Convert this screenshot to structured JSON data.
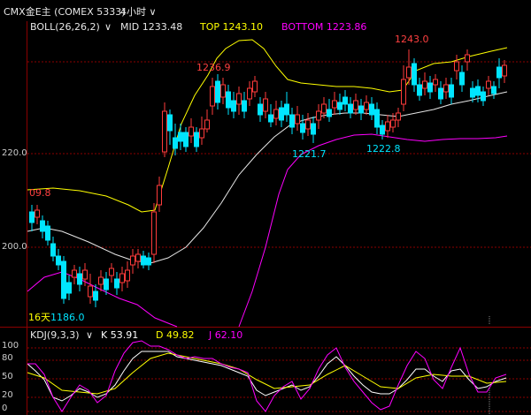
{
  "header": {
    "title": "CMX金E主 (COMEX 5333)",
    "period": "4小时",
    "period_icon": "chevron-down-icon"
  },
  "boll": {
    "label": "BOLL(26,26,2)",
    "mid": "MID 1233.48",
    "top": "TOP 1243.10",
    "bottom": "BOTTOM 1223.86",
    "colors": {
      "label": "#e6e6e6",
      "mid": "#e6e6e6",
      "top": "#ffff00",
      "bottom": "#ff00ff"
    }
  },
  "price_axis": {
    "labels": [
      "220.0",
      "200.0"
    ]
  },
  "annotations": {
    "high_left": "09.8",
    "peak1": "1236.9",
    "low1": "1221.7",
    "low2": "1222.8",
    "peak2": "1243.0",
    "low_left": "1186.0",
    "day_marker": "16天"
  },
  "kdj": {
    "label": "KDJ(9,3,3)",
    "k": "K 53.91",
    "d": "D 49.82",
    "j": "J 62.10",
    "axis_labels": [
      "100",
      "80",
      "50",
      "20",
      "0"
    ],
    "colors": {
      "k": "#ffffff",
      "d": "#ffff00",
      "j": "#ff00ff"
    }
  },
  "colors": {
    "up": "#ff3b3b",
    "down": "#00e5ff",
    "grid": "#8b0000",
    "background": "#000000"
  }
}
